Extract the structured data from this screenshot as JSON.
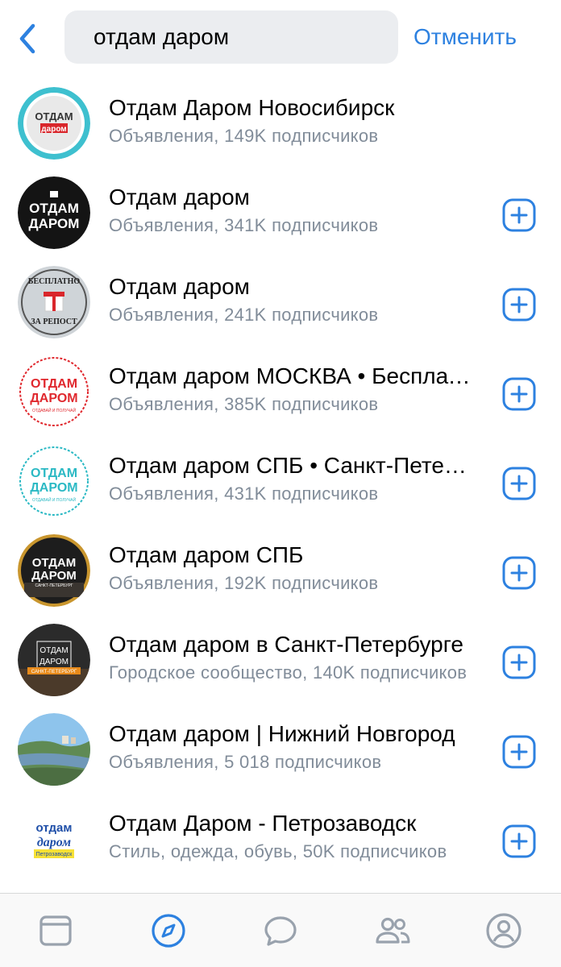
{
  "search": {
    "query": "отдам даром",
    "cancel_label": "Отменить"
  },
  "colors": {
    "accent": "#2d81e0",
    "secondary_text": "#818c99",
    "icon_gray": "#99a2ad"
  },
  "results": [
    {
      "title": "Отдам Даром Новосибирск",
      "subtitle": "Объявления, 149K подписчиков",
      "avatar_text": "ОТДАМ даром",
      "has_add": false
    },
    {
      "title": "Отдам даром",
      "subtitle": "Объявления, 341K подписчиков",
      "avatar_text": "ОТДАМ ДАРОМ",
      "has_add": true
    },
    {
      "title": "Отдам даром",
      "subtitle": "Объявления, 241K подписчиков",
      "avatar_text": "БЕСПЛАТНО ЗА РЕПОСТ",
      "has_add": true
    },
    {
      "title": "Отдам даром МОСКВА • Бесплатно",
      "subtitle": "Объявления, 385K подписчиков",
      "avatar_text": "ОТДАМ ДАРОМ",
      "avatar_small": "отдавай и получай",
      "has_add": true
    },
    {
      "title": "Отдам даром СПБ • Санкт-Петербург",
      "subtitle": "Объявления, 431K подписчиков",
      "avatar_text": "ОТДАМ ДАРОМ",
      "avatar_small": "отдавай и получай",
      "has_add": true
    },
    {
      "title": "Отдам даром СПБ",
      "subtitle": "Объявления, 192K подписчиков",
      "avatar_text": "ОТДАМ ДАРОМ",
      "avatar_small": "САНКТ-ПЕТЕРБУРГ",
      "has_add": true
    },
    {
      "title": "Отдам даром в Санкт-Петербурге",
      "subtitle": "Городское сообщество, 140K подписчиков",
      "avatar_text": "ОТДАМ ДАРОМ",
      "avatar_small": "САНКТ-ПЕТЕРБУРГ",
      "has_add": true
    },
    {
      "title": "Отдам даром | Нижний Новгород",
      "subtitle": "Объявления, 5 018 подписчиков",
      "avatar_text": "",
      "has_add": true
    },
    {
      "title": "Отдам Даром - Петрозаводск",
      "subtitle": "Стиль, одежда, обувь, 50K подписчиков",
      "avatar_text": "отдам даром",
      "avatar_small": "Петрозаводск",
      "has_add": true
    }
  ],
  "tabbar": {
    "tabs": [
      "feed-icon",
      "explore-icon",
      "messages-icon",
      "friends-icon",
      "profile-icon"
    ],
    "active": "explore-icon"
  }
}
